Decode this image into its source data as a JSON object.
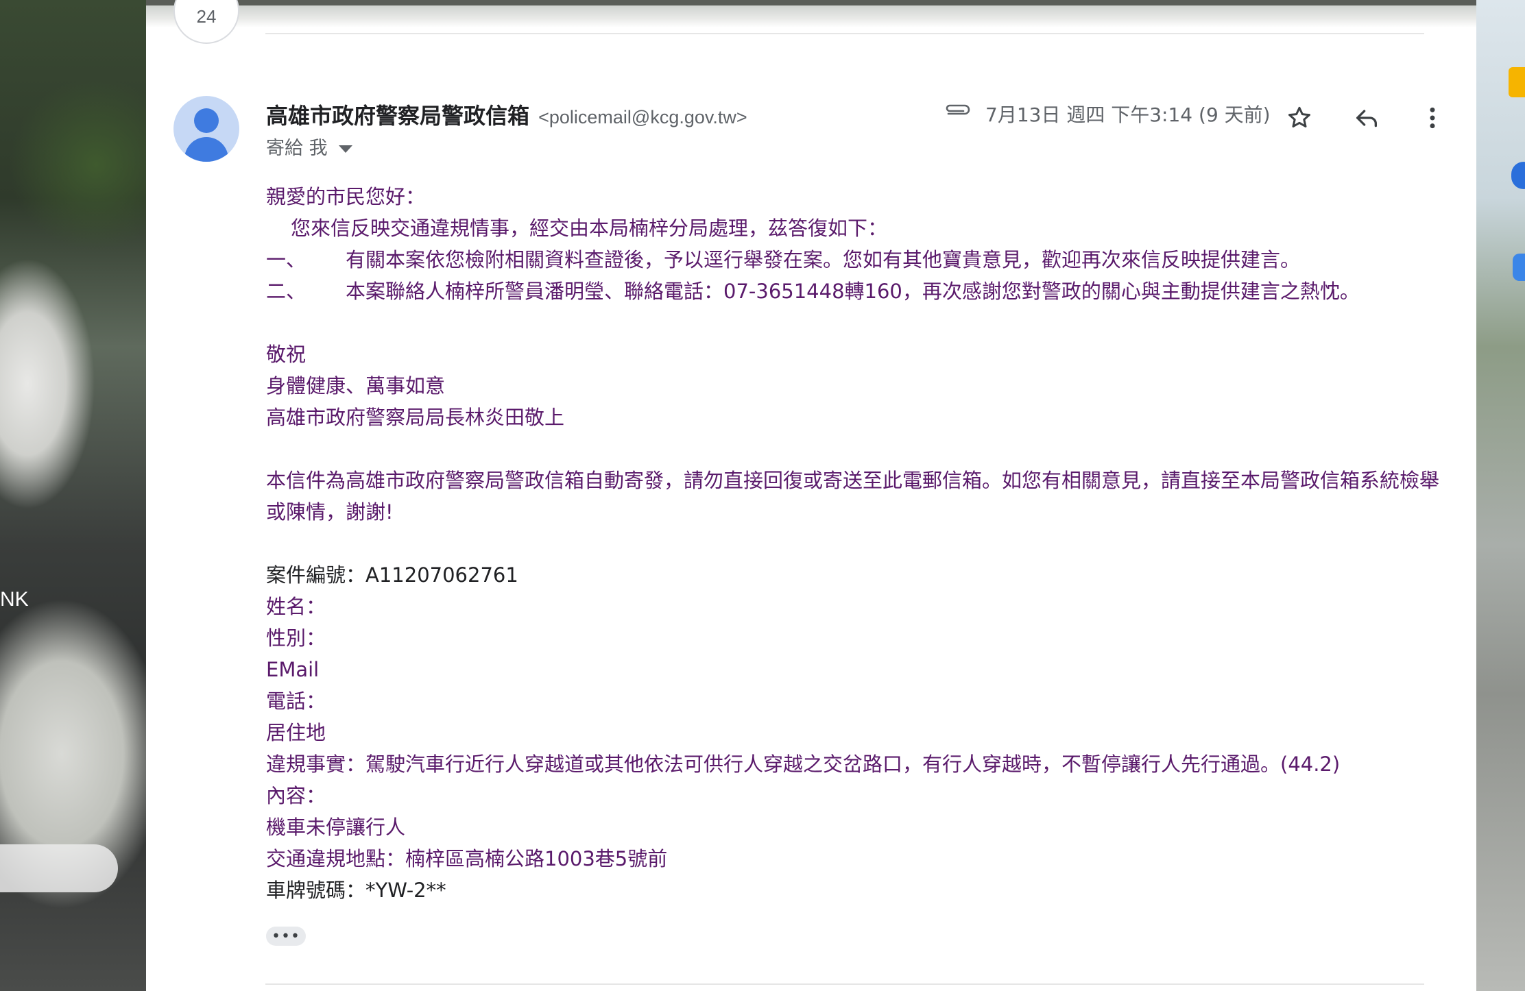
{
  "thread": {
    "message_count": "24"
  },
  "email": {
    "sender_name": "高雄市政府警察局警政信箱",
    "sender_email": "<policemail@kcg.gov.tw>",
    "recipient_label": "寄給 我",
    "date": "7月13日 週四 下午3:14 (9 天前)",
    "body": {
      "greeting": "親愛的市民您好：",
      "intro": "您來信反映交通違規情事，經交由本局楠梓分局處理，茲答復如下：",
      "item1_num": "一、",
      "item1_text": "有關本案依您檢附相關資料查證後，予以逕行舉發在案。您如有其他寶貴意見，歡迎再次來信反映提供建言。",
      "item2_num": "二、",
      "item2_text": "本案聯絡人楠梓所警員潘明瑩、聯絡電話：07-3651448轉160，再次感謝您對警政的關心與主動提供建言之熱忱。",
      "closing1": "敬祝",
      "closing2": "身體健康、萬事如意",
      "signature": "高雄市政府警察局局長林炎田敬上",
      "notice": "本信件為高雄市政府警察局警政信箱自動寄發，請勿直接回復或寄送至此電郵信箱。如您有相關意見，請直接至本局警政信箱系統檢舉或陳情，謝謝!",
      "case_number": "案件編號：A11207062761",
      "name": "姓名：",
      "gender": "性別：",
      "email_label": "EMail",
      "phone": "電話：",
      "address": "居住地",
      "violation": "違規事實：駕駛汽車行近行人穿越道或其他依法可供行人穿越之交岔路口，有行人穿越時，不暫停讓行人先行通過。(44.2)",
      "content_label": "內容：",
      "content": "機車未停讓行人",
      "location": "交通違規地點：楠梓區高楠公路1003巷5號前",
      "plate": "車牌號碼：*YW-2**"
    },
    "show_trimmed": "•••"
  },
  "background": {
    "left_text": "NK"
  },
  "colors": {
    "body_text": "#202124",
    "notice_text": "#5a1a6b",
    "avatar": "#3f7be0",
    "secondary": "#5f6368"
  }
}
